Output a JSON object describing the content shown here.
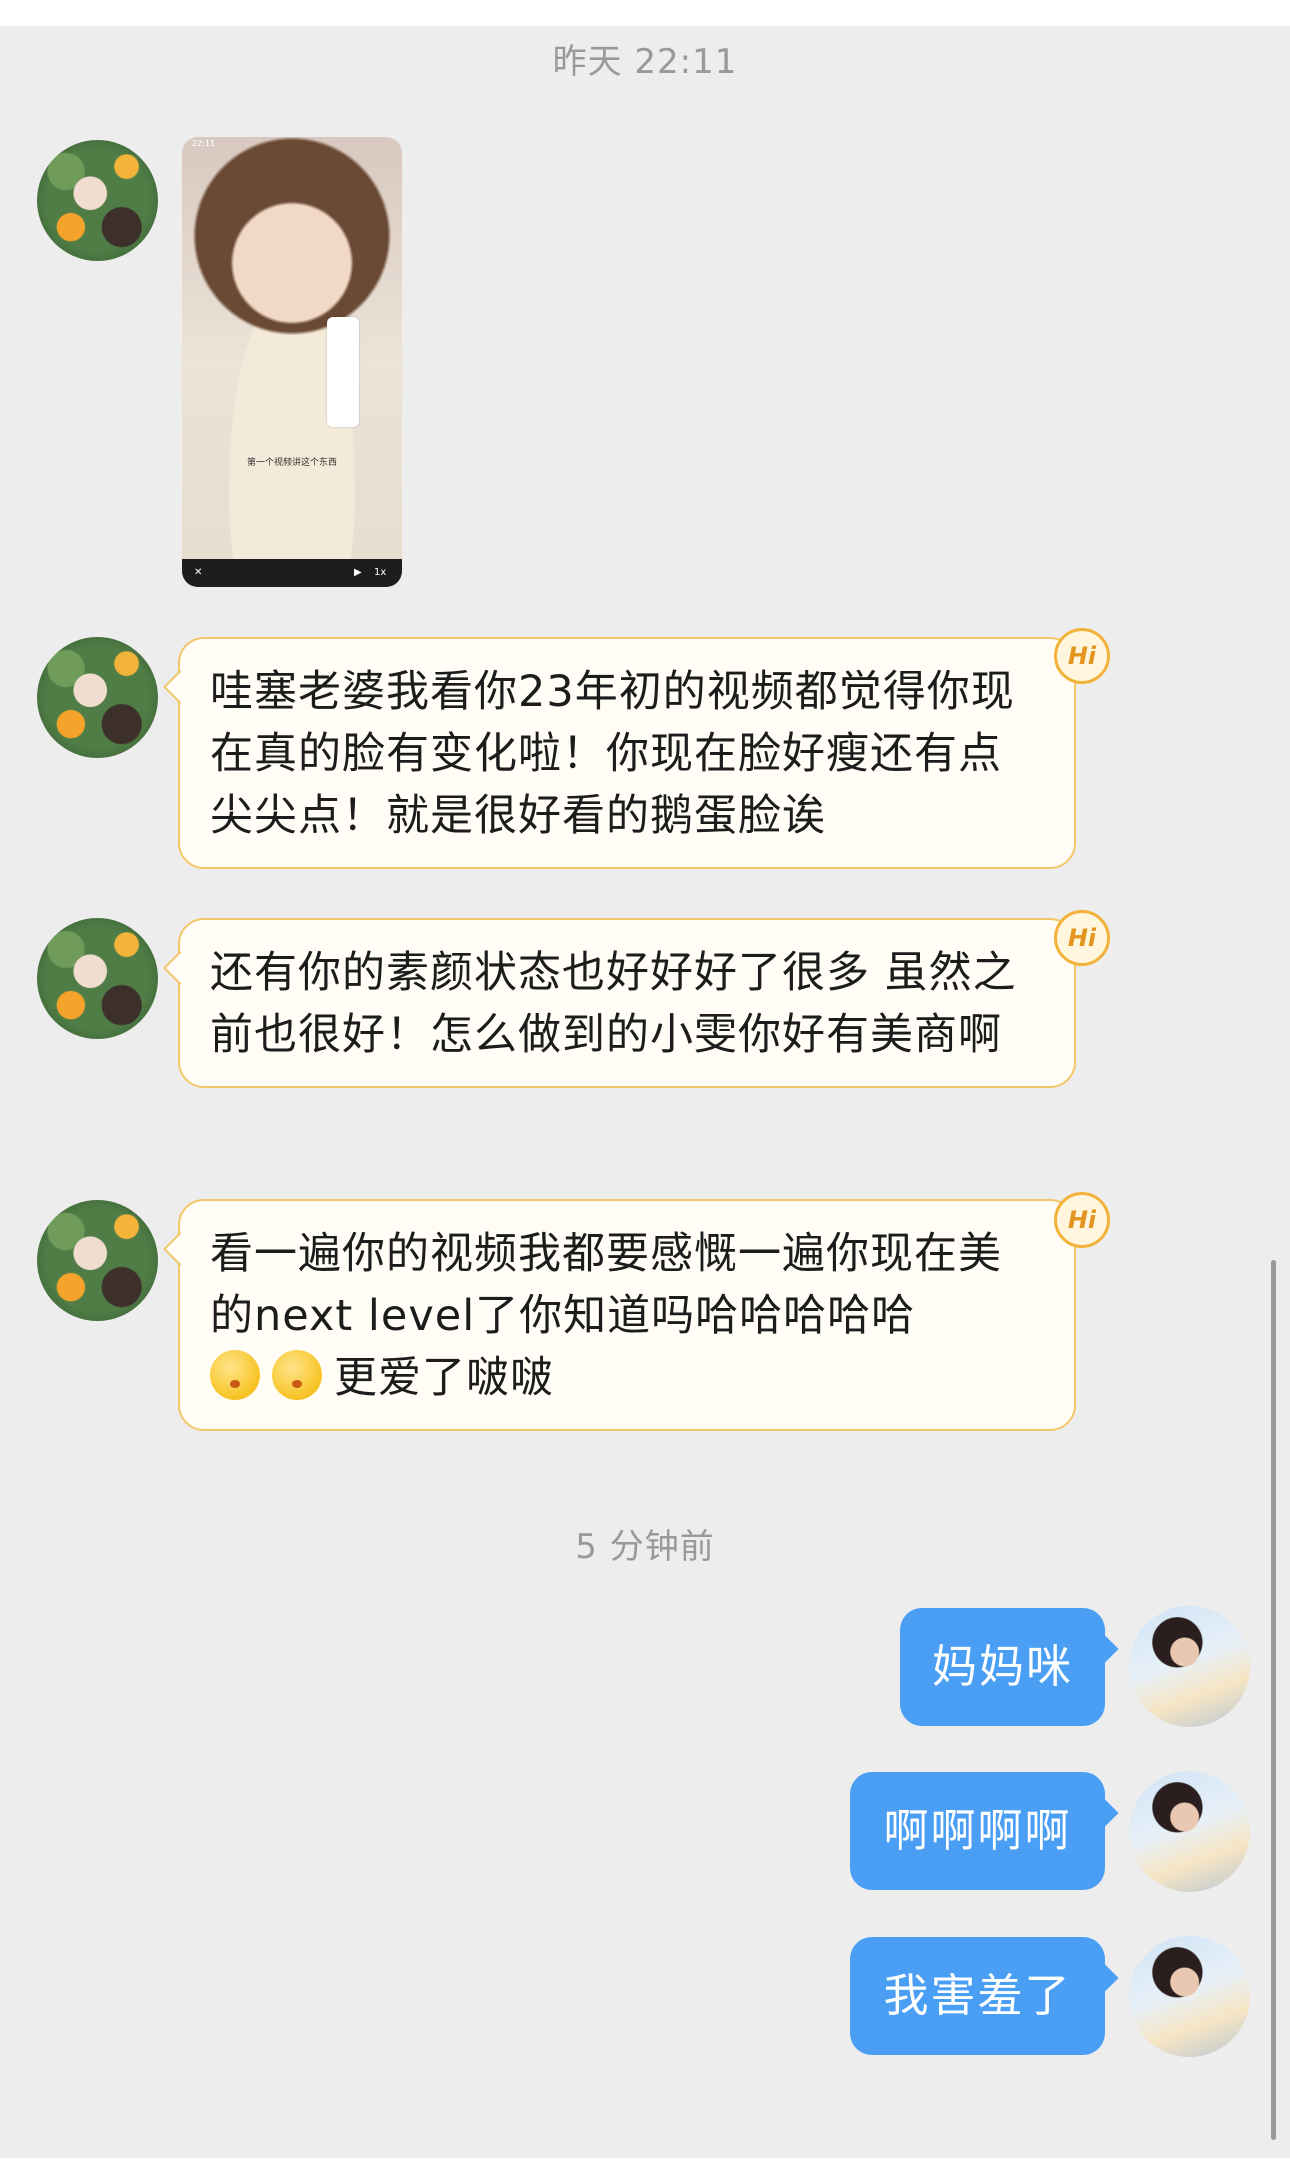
{
  "timestamps": [
    "昨天 22:11",
    "5 分钟前"
  ],
  "video_message": {
    "status_time": "22:11",
    "subtitle": "第一个视频讲这个东西",
    "control_close": "✕",
    "control_play": "▶",
    "control_speed": "1x"
  },
  "incoming_messages": [
    {
      "text": "哇塞老婆我看你23年初的视频都觉得你现在真的脸有变化啦！你现在脸好瘦还有点尖尖点！就是很好看的鹅蛋脸诶"
    },
    {
      "text": "还有你的素颜状态也好好好了很多 虽然之前也很好！怎么做到的小雯你好有美商啊"
    },
    {
      "text_main": "看一遍你的视频我都要感慨一遍你现在美的next level了你知道吗哈哈哈哈哈",
      "text_tail": "更爱了啵啵",
      "emoji_name": "kissing-face-emoji"
    }
  ],
  "badge_label": "Hi",
  "outgoing_messages": [
    "妈妈咪",
    "啊啊啊啊",
    "我害羞了"
  ],
  "colors": {
    "background": "#ededed",
    "incoming_border": "#f3c768",
    "incoming_fill": "#fffdf6",
    "outgoing_fill": "#4a9ff4",
    "timestamp": "#999999"
  }
}
